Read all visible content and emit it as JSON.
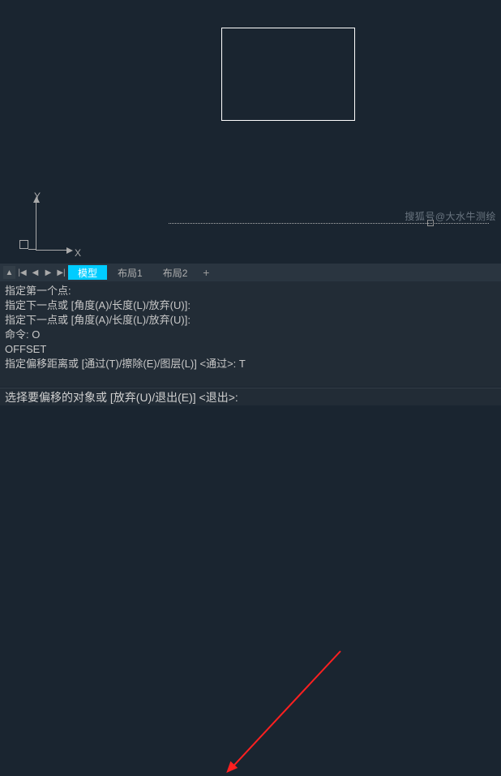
{
  "drawing": {
    "axis_x": "X",
    "axis_y": "Y"
  },
  "watermark": "搜狐号@大水牛测绘",
  "tabs": {
    "model": "模型",
    "layout1": "布局1",
    "layout2": "布局2",
    "add": "+"
  },
  "command_history": {
    "line1": "指定第一个点:",
    "line2": "指定下一点或 [角度(A)/长度(L)/放弃(U)]:",
    "line3": "指定下一点或 [角度(A)/长度(L)/放弃(U)]:",
    "line4": "命令: O",
    "line5": "OFFSET",
    "line6": "指定偏移距离或 [通过(T)/擦除(E)/图层(L)] <通过>: T"
  },
  "command_input": {
    "prompt": "选择要偏移的对象或 [放弃(U)/退出(E)] <退出>:"
  }
}
